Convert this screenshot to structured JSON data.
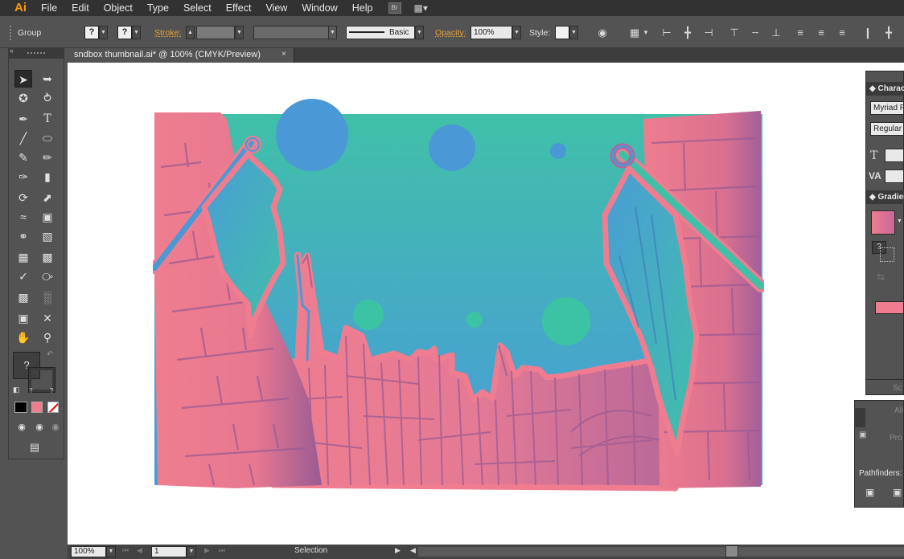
{
  "app": {
    "logo": "Ai",
    "bridge_label": "Br",
    "workspace_icon": "grid-layout-icon"
  },
  "menu": [
    "File",
    "Edit",
    "Object",
    "Type",
    "Select",
    "Effect",
    "View",
    "Window",
    "Help"
  ],
  "control": {
    "selection_type": "Group",
    "fill_swatch": "?",
    "stroke_swatch": "?",
    "stroke_label": "Stroke:",
    "stroke_profile": "Basic",
    "opacity_label": "Opacity:",
    "opacity_value": "100%",
    "style_label": "Style:"
  },
  "document": {
    "tab_title": "sndbox thumbnail.ai* @ 100% (CMYK/Preview)",
    "close_glyph": "×"
  },
  "toolbox": {
    "fill_stroke_glyph": "?",
    "small_fill_glyph": "?",
    "small_stroke_glyph": "?"
  },
  "panels": {
    "character": {
      "title": "Characte",
      "font_family": "Myriad P",
      "font_style": "Regular",
      "size_glyph": "T",
      "tracking_glyph": "VA"
    },
    "gradient": {
      "title": "Gradien",
      "question_glyph": "?"
    },
    "pathfinder": {
      "label": "Pathfinders:",
      "scale_text": "Sc",
      "align_text": "Ali",
      "profile_text": "Pro"
    }
  },
  "status": {
    "zoom": "100%",
    "artboard_number": "1",
    "tool_name": "Selection"
  },
  "colors": {
    "accent_orange": "#e8a13a",
    "sky_top": "#40c0a8",
    "sky_bottom": "#4a9cd6",
    "city_pink": "#ef7d8f",
    "city_purple": "#9a5b94",
    "planet_blue": "#4b98d6",
    "moon_green": "#3cc3a4"
  }
}
